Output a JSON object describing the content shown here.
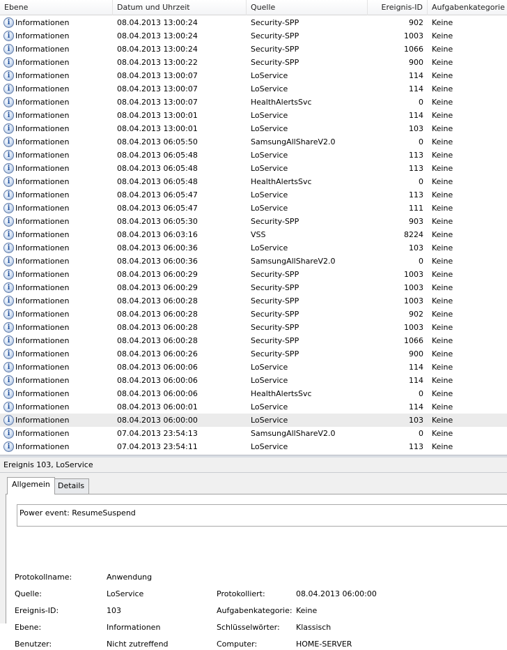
{
  "columns": {
    "level": "Ebene",
    "datetime": "Datum und Uhrzeit",
    "source": "Quelle",
    "event_id": "Ereignis-ID",
    "category": "Aufgabenkategorie"
  },
  "icon": "information-icon",
  "colors": {
    "selected_row": "#ebebeb",
    "icon_blue": "#1d4e9c"
  },
  "rows": [
    {
      "level": "Informationen",
      "datetime": "08.04.2013 13:00:24",
      "source": "Security-SPP",
      "id": "902",
      "category": "Keine"
    },
    {
      "level": "Informationen",
      "datetime": "08.04.2013 13:00:24",
      "source": "Security-SPP",
      "id": "1003",
      "category": "Keine"
    },
    {
      "level": "Informationen",
      "datetime": "08.04.2013 13:00:24",
      "source": "Security-SPP",
      "id": "1066",
      "category": "Keine"
    },
    {
      "level": "Informationen",
      "datetime": "08.04.2013 13:00:22",
      "source": "Security-SPP",
      "id": "900",
      "category": "Keine"
    },
    {
      "level": "Informationen",
      "datetime": "08.04.2013 13:00:07",
      "source": "LoService",
      "id": "114",
      "category": "Keine"
    },
    {
      "level": "Informationen",
      "datetime": "08.04.2013 13:00:07",
      "source": "LoService",
      "id": "114",
      "category": "Keine"
    },
    {
      "level": "Informationen",
      "datetime": "08.04.2013 13:00:07",
      "source": "HealthAlertsSvc",
      "id": "0",
      "category": "Keine"
    },
    {
      "level": "Informationen",
      "datetime": "08.04.2013 13:00:01",
      "source": "LoService",
      "id": "114",
      "category": "Keine"
    },
    {
      "level": "Informationen",
      "datetime": "08.04.2013 13:00:01",
      "source": "LoService",
      "id": "103",
      "category": "Keine"
    },
    {
      "level": "Informationen",
      "datetime": "08.04.2013 06:05:50",
      "source": "SamsungAllShareV2.0",
      "id": "0",
      "category": "Keine"
    },
    {
      "level": "Informationen",
      "datetime": "08.04.2013 06:05:48",
      "source": "LoService",
      "id": "113",
      "category": "Keine"
    },
    {
      "level": "Informationen",
      "datetime": "08.04.2013 06:05:48",
      "source": "LoService",
      "id": "113",
      "category": "Keine"
    },
    {
      "level": "Informationen",
      "datetime": "08.04.2013 06:05:48",
      "source": "HealthAlertsSvc",
      "id": "0",
      "category": "Keine"
    },
    {
      "level": "Informationen",
      "datetime": "08.04.2013 06:05:47",
      "source": "LoService",
      "id": "113",
      "category": "Keine"
    },
    {
      "level": "Informationen",
      "datetime": "08.04.2013 06:05:47",
      "source": "LoService",
      "id": "111",
      "category": "Keine"
    },
    {
      "level": "Informationen",
      "datetime": "08.04.2013 06:05:30",
      "source": "Security-SPP",
      "id": "903",
      "category": "Keine"
    },
    {
      "level": "Informationen",
      "datetime": "08.04.2013 06:03:16",
      "source": "VSS",
      "id": "8224",
      "category": "Keine"
    },
    {
      "level": "Informationen",
      "datetime": "08.04.2013 06:00:36",
      "source": "LoService",
      "id": "103",
      "category": "Keine"
    },
    {
      "level": "Informationen",
      "datetime": "08.04.2013 06:00:36",
      "source": "SamsungAllShareV2.0",
      "id": "0",
      "category": "Keine"
    },
    {
      "level": "Informationen",
      "datetime": "08.04.2013 06:00:29",
      "source": "Security-SPP",
      "id": "1003",
      "category": "Keine"
    },
    {
      "level": "Informationen",
      "datetime": "08.04.2013 06:00:29",
      "source": "Security-SPP",
      "id": "1003",
      "category": "Keine"
    },
    {
      "level": "Informationen",
      "datetime": "08.04.2013 06:00:28",
      "source": "Security-SPP",
      "id": "1003",
      "category": "Keine"
    },
    {
      "level": "Informationen",
      "datetime": "08.04.2013 06:00:28",
      "source": "Security-SPP",
      "id": "902",
      "category": "Keine"
    },
    {
      "level": "Informationen",
      "datetime": "08.04.2013 06:00:28",
      "source": "Security-SPP",
      "id": "1003",
      "category": "Keine"
    },
    {
      "level": "Informationen",
      "datetime": "08.04.2013 06:00:28",
      "source": "Security-SPP",
      "id": "1066",
      "category": "Keine"
    },
    {
      "level": "Informationen",
      "datetime": "08.04.2013 06:00:26",
      "source": "Security-SPP",
      "id": "900",
      "category": "Keine"
    },
    {
      "level": "Informationen",
      "datetime": "08.04.2013 06:00:06",
      "source": "LoService",
      "id": "114",
      "category": "Keine"
    },
    {
      "level": "Informationen",
      "datetime": "08.04.2013 06:00:06",
      "source": "LoService",
      "id": "114",
      "category": "Keine"
    },
    {
      "level": "Informationen",
      "datetime": "08.04.2013 06:00:06",
      "source": "HealthAlertsSvc",
      "id": "0",
      "category": "Keine"
    },
    {
      "level": "Informationen",
      "datetime": "08.04.2013 06:00:01",
      "source": "LoService",
      "id": "114",
      "category": "Keine"
    },
    {
      "level": "Informationen",
      "datetime": "08.04.2013 06:00:00",
      "source": "LoService",
      "id": "103",
      "category": "Keine",
      "selected": true
    },
    {
      "level": "Informationen",
      "datetime": "07.04.2013 23:54:13",
      "source": "SamsungAllShareV2.0",
      "id": "0",
      "category": "Keine"
    },
    {
      "level": "Informationen",
      "datetime": "07.04.2013 23:54:11",
      "source": "LoService",
      "id": "113",
      "category": "Keine"
    }
  ],
  "detail": {
    "title": "Ereignis 103, LoService",
    "tabs": {
      "general": "Allgemein",
      "details": "Details"
    },
    "message": "Power event: ResumeSuspend",
    "fields": {
      "log_name_label": "Protokollname:",
      "log_name": "Anwendung",
      "source_label": "Quelle:",
      "source": "LoService",
      "logged_label": "Protokolliert:",
      "logged": "08.04.2013 06:00:00",
      "event_id_label": "Ereignis-ID:",
      "event_id": "103",
      "task_category_label": "Aufgabenkategorie:",
      "task_category": "Keine",
      "level_label": "Ebene:",
      "level": "Informationen",
      "keywords_label": "Schlüsselwörter:",
      "keywords": "Klassisch",
      "user_label": "Benutzer:",
      "user": "Nicht zutreffend",
      "computer_label": "Computer:",
      "computer": "HOME-SERVER"
    }
  }
}
